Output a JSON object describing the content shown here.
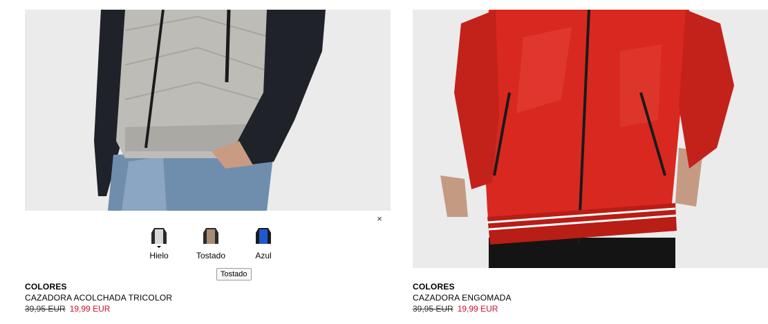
{
  "products": [
    {
      "label": "COLORES",
      "title": "CAZADORA ACOLCHADA TRICOLOR",
      "old_price": "39,95 EUR",
      "new_price": "19,99 EUR",
      "close_icon": "×",
      "swatches": [
        {
          "name": "Hielo",
          "icon": "jacket-thumbnail-icon",
          "color": "#d8d8d8",
          "selected": true
        },
        {
          "name": "Tostado",
          "icon": "jacket-thumbnail-icon",
          "color": "#a88b73"
        },
        {
          "name": "Azul",
          "icon": "jacket-thumbnail-icon",
          "color": "#1f58d1"
        }
      ],
      "tooltip": "Tostado"
    },
    {
      "label": "COLORES",
      "title": "CAZADORA ENGOMADA",
      "old_price": "39,95 EUR",
      "new_price": "19,99 EUR"
    }
  ],
  "colors": {
    "sale_price": "#c8102e",
    "photo_bg": "#ebebeb",
    "jacket_red": "#d9281f"
  }
}
